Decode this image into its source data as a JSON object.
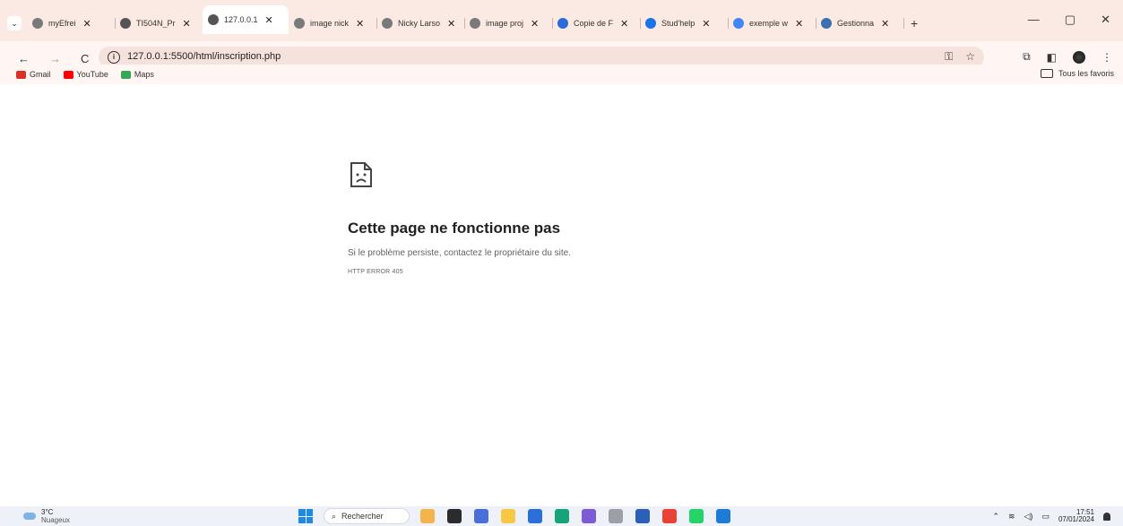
{
  "browser": {
    "tabs": [
      {
        "title": "myEfrei",
        "color": "#7a7a7a",
        "active": false
      },
      {
        "title": "TI504N_Pr",
        "color": "#555555",
        "active": false
      },
      {
        "title": "127.0.0.1",
        "color": "#555555",
        "active": true
      },
      {
        "title": "image nick",
        "color": "#7a7a7a",
        "active": false
      },
      {
        "title": "Nicky Larso",
        "color": "#7a7a7a",
        "active": false
      },
      {
        "title": "image proj",
        "color": "#7a7a7a",
        "active": false
      },
      {
        "title": "Copie de F",
        "color": "#2f6ad9",
        "active": false
      },
      {
        "title": "Stud'help",
        "color": "#1a73e8",
        "active": false
      },
      {
        "title": "exemple w",
        "color": "#4285f4",
        "active": false
      },
      {
        "title": "Gestionna",
        "color": "#3a6fb0",
        "active": false
      }
    ],
    "close_glyph": "✕",
    "new_tab_glyph": "+",
    "window_controls": {
      "minimize": "—",
      "maximize": "▢",
      "close": "✕"
    },
    "nav": {
      "back": "←",
      "forward": "→",
      "reload": "C"
    },
    "url": "127.0.0.1:5500/html/inscription.php",
    "bookmarks": [
      {
        "label": "Gmail",
        "color": "#d93025"
      },
      {
        "label": "YouTube",
        "color": "#ff0000"
      },
      {
        "label": "Maps",
        "color": "#34a853"
      }
    ],
    "all_bookmarks_label": "Tous les favoris"
  },
  "error_page": {
    "title": "Cette page ne fonctionne pas",
    "message": "Si le problème persiste, contactez le propriétaire du site.",
    "code": "HTTP ERROR 405"
  },
  "taskbar": {
    "weather_temp": "3°C",
    "weather_desc": "Nuageux",
    "search_label": "Rechercher",
    "time": "17:51",
    "date": "07/01/2024",
    "app_colors": [
      "#f2b44b",
      "#2b2b2b",
      "#4b6fd8",
      "#f7c843",
      "#2a6fdb",
      "#17a37a",
      "#7b5bd6",
      "#9aa0a6",
      "#2b5fb8",
      "#e94235",
      "#25d366",
      "#1e7bd6"
    ]
  }
}
